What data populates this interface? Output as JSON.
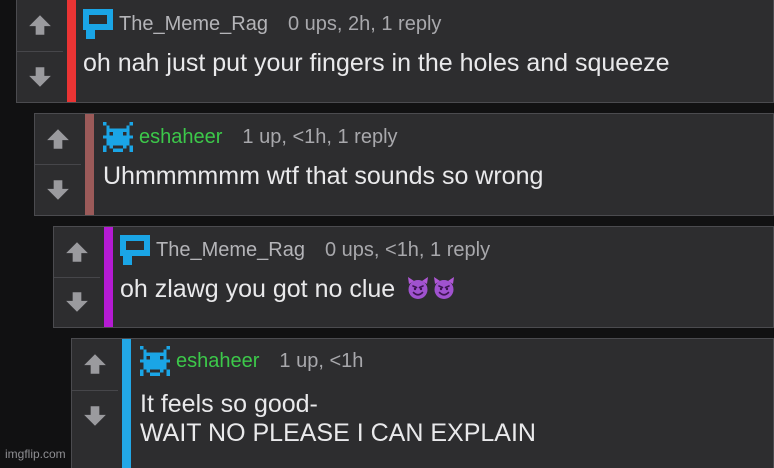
{
  "colors": {
    "page_bg": "#111112",
    "comment_bg": "#2d2d2f",
    "accent_blue": "#1aa5e6",
    "accent_green": "#3cc84a",
    "stripe_red": "#ea3434",
    "stripe_brown": "#9b5a59",
    "stripe_purple": "#b51bd4",
    "stripe_blue": "#22a7e6"
  },
  "comments": [
    {
      "username": "The_Meme_Rag",
      "avatar_icon": "blue-pixel-speech-bubble-avatar",
      "stats": "0 ups, 2h, 1 reply",
      "text": "oh nah just put your fingers in the holes and squeeze"
    },
    {
      "username": "eshaheer",
      "avatar_icon": "green-pixel-invader-avatar",
      "stats": "1 up, <1h, 1 reply",
      "text": "Uhmmmmmm wtf that sounds so wrong"
    },
    {
      "username": "The_Meme_Rag",
      "avatar_icon": "blue-pixel-speech-bubble-avatar",
      "stats": "0 ups, <1h, 1 reply",
      "text": "oh zlawg you got no clue",
      "emojis": [
        "smiling-devil-emoji",
        "smiling-devil-emoji"
      ]
    },
    {
      "username": "eshaheer",
      "avatar_icon": "green-pixel-invader-avatar",
      "stats": "1 up, <1h",
      "text_line1": "It feels so good-",
      "text_line2": "WAIT NO PLEASE I CAN EXPLAIN"
    }
  ],
  "watermark": "imgflip.com"
}
